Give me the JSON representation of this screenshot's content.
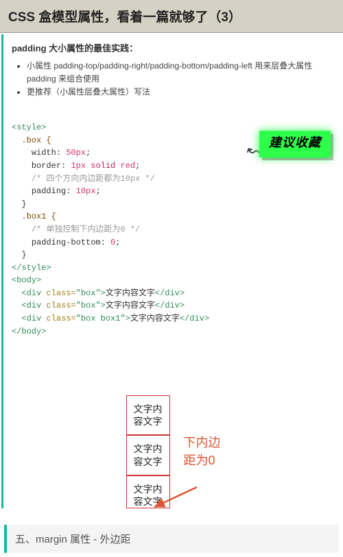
{
  "title": "CSS 盒模型属性，看着一篇就够了（3）",
  "subhead": "padding 大小属性的最佳实践：",
  "bullets": [
    "小属性 padding-top/padding-right/padding-bottom/padding-left 用来层叠大属性 padding 来组合使用",
    "更推荐（小属性层叠大属性）写法"
  ],
  "code": {
    "open_style": "<style>",
    "sel_box": ".box {",
    "width_lbl": "width:",
    "width_val": " 50px",
    "semicolon": ";",
    "border_lbl": "border:",
    "border_val1": " 1px ",
    "border_kw": "solid",
    "border_val2": " red",
    "comment1": "/* 四个方向内边距都为10px */",
    "padding_lbl": "padding:",
    "padding_val": " 10px",
    "close_brace": "}",
    "sel_box1": ".box1 {",
    "comment2": "/* 单独控制下内边距为0 */",
    "pb_lbl": "padding-bottom:",
    "pb_val": " 0",
    "close_style": "</style>",
    "open_body": "<body>",
    "div_open": "<div ",
    "class_attr": "class=",
    "class_val1": "\"box\"",
    "div_close_open": ">",
    "div_text": "文字内容文字",
    "div_end": "</div>",
    "class_val2": "\"box box1\"",
    "close_body": "</body>"
  },
  "badge": "建议收藏",
  "demo_text": "文字内容文字",
  "annotation_l1": "下内边",
  "annotation_l2": "距为0",
  "section2": "五、margin 属性 - 外边距"
}
